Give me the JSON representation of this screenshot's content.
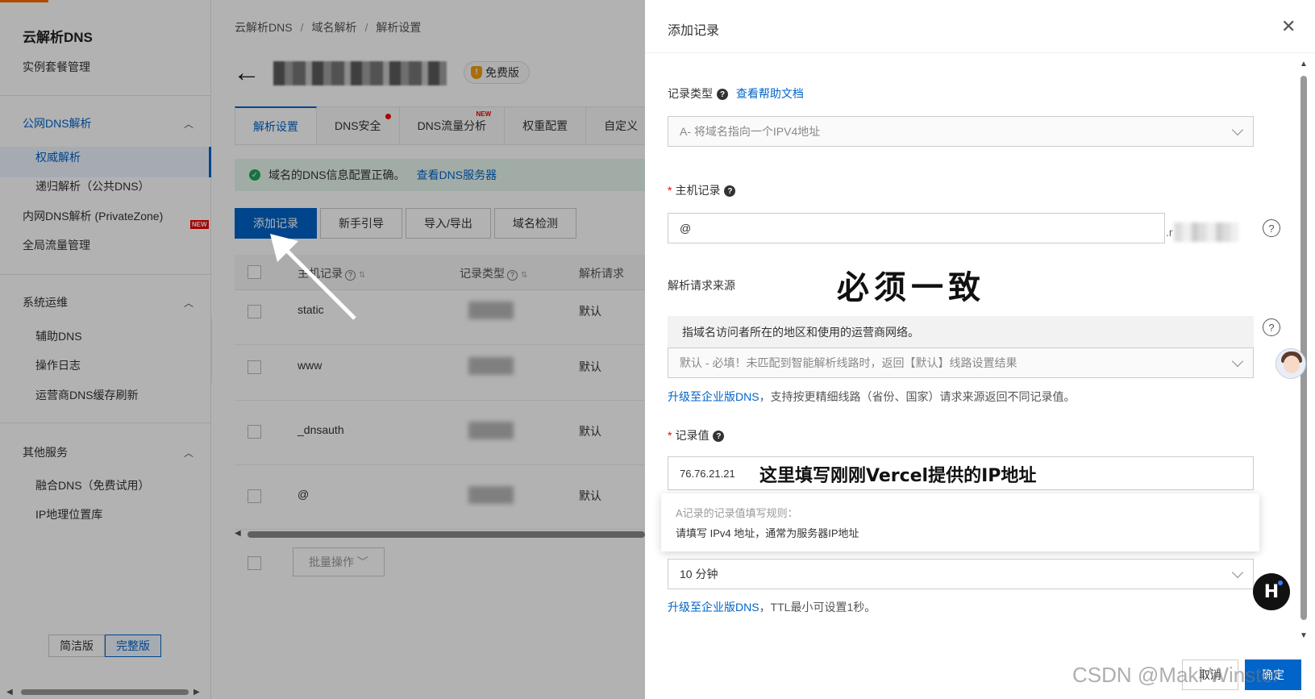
{
  "sidebar": {
    "title": "云解析DNS",
    "instance_mgmt": "实例套餐管理",
    "group_public": "公网DNS解析",
    "authoritative": "权威解析",
    "recursive": "递归解析（公共DNS）",
    "private_zone": "内网DNS解析 (PrivateZone)",
    "private_zone_badge": "NEW",
    "global_traffic": "全局流量管理",
    "group_ops": "系统运维",
    "aux_dns": "辅助DNS",
    "op_log": "操作日志",
    "isp_cache": "运营商DNS缓存刷新",
    "group_other": "其他服务",
    "fusion_dns": "融合DNS（免费试用）",
    "ip_geo": "IP地理位置库",
    "version_simple": "简洁版",
    "version_full": "完整版"
  },
  "main": {
    "breadcrumb": [
      "云解析DNS",
      "域名解析",
      "解析设置"
    ],
    "free_badge": "免费版",
    "tabs": [
      {
        "label": "解析设置"
      },
      {
        "label": "DNS安全"
      },
      {
        "label": "DNS流量分析",
        "badge": "NEW"
      },
      {
        "label": "权重配置"
      },
      {
        "label": "自定义"
      }
    ],
    "alert_text": "域名的DNS信息配置正确。",
    "alert_link": "查看DNS服务器",
    "toolbar": [
      "添加记录",
      "新手引导",
      "导入/导出",
      "域名检测"
    ],
    "columns": [
      "主机记录",
      "记录类型",
      "解析请求"
    ],
    "rows": [
      {
        "host": "static",
        "line": "默认"
      },
      {
        "host": "www",
        "line": "默认"
      },
      {
        "host": "_dnsauth",
        "line": "默认"
      },
      {
        "host": "@",
        "line": "默认"
      }
    ],
    "batch_label": "批量操作"
  },
  "drawer": {
    "title": "添加记录",
    "record_type_label": "记录类型",
    "help_doc_link": "查看帮助文档",
    "record_type_value": "A- 将域名指向一个IPV4地址",
    "host_label": "主机记录",
    "host_value": "@",
    "host_suffix": ".r",
    "source_label": "解析请求来源",
    "source_hint": "指域名访问者所在的地区和使用的运营商网络。",
    "source_value": "默认 - 必填！未匹配到智能解析线路时，返回【默认】线路设置结果",
    "upgrade_link": "升级至企业版DNS",
    "upgrade_note_line": "，支持按更精细线路（省份、国家）请求来源返回不同记录值。",
    "record_value_label": "记录值",
    "record_value": "76.76.21.21",
    "tooltip_title": "A记录的记录值填写规则：",
    "tooltip_body": "请填写 IPv4 地址，通常为服务器IP地址",
    "ttl_value": "10 分钟",
    "upgrade_note_ttl": "，TTL最小可设置1秒。",
    "cancel": "取消",
    "ok": "确定"
  },
  "annotations": {
    "must_match": "必须一致",
    "fill_ip": "这里填写刚刚Vercel提供的IP地址"
  },
  "watermark": "CSDN @Maki Winster",
  "icons": [
    "back-arrow-icon",
    "shield-icon",
    "check-circle-icon",
    "help-icon",
    "close-icon",
    "chevron-down-icon",
    "chevron-up-icon"
  ],
  "colors": {
    "primary": "#0064c8",
    "required": "#e00000",
    "success": "#23a55a",
    "brand": "#ff6a00"
  }
}
